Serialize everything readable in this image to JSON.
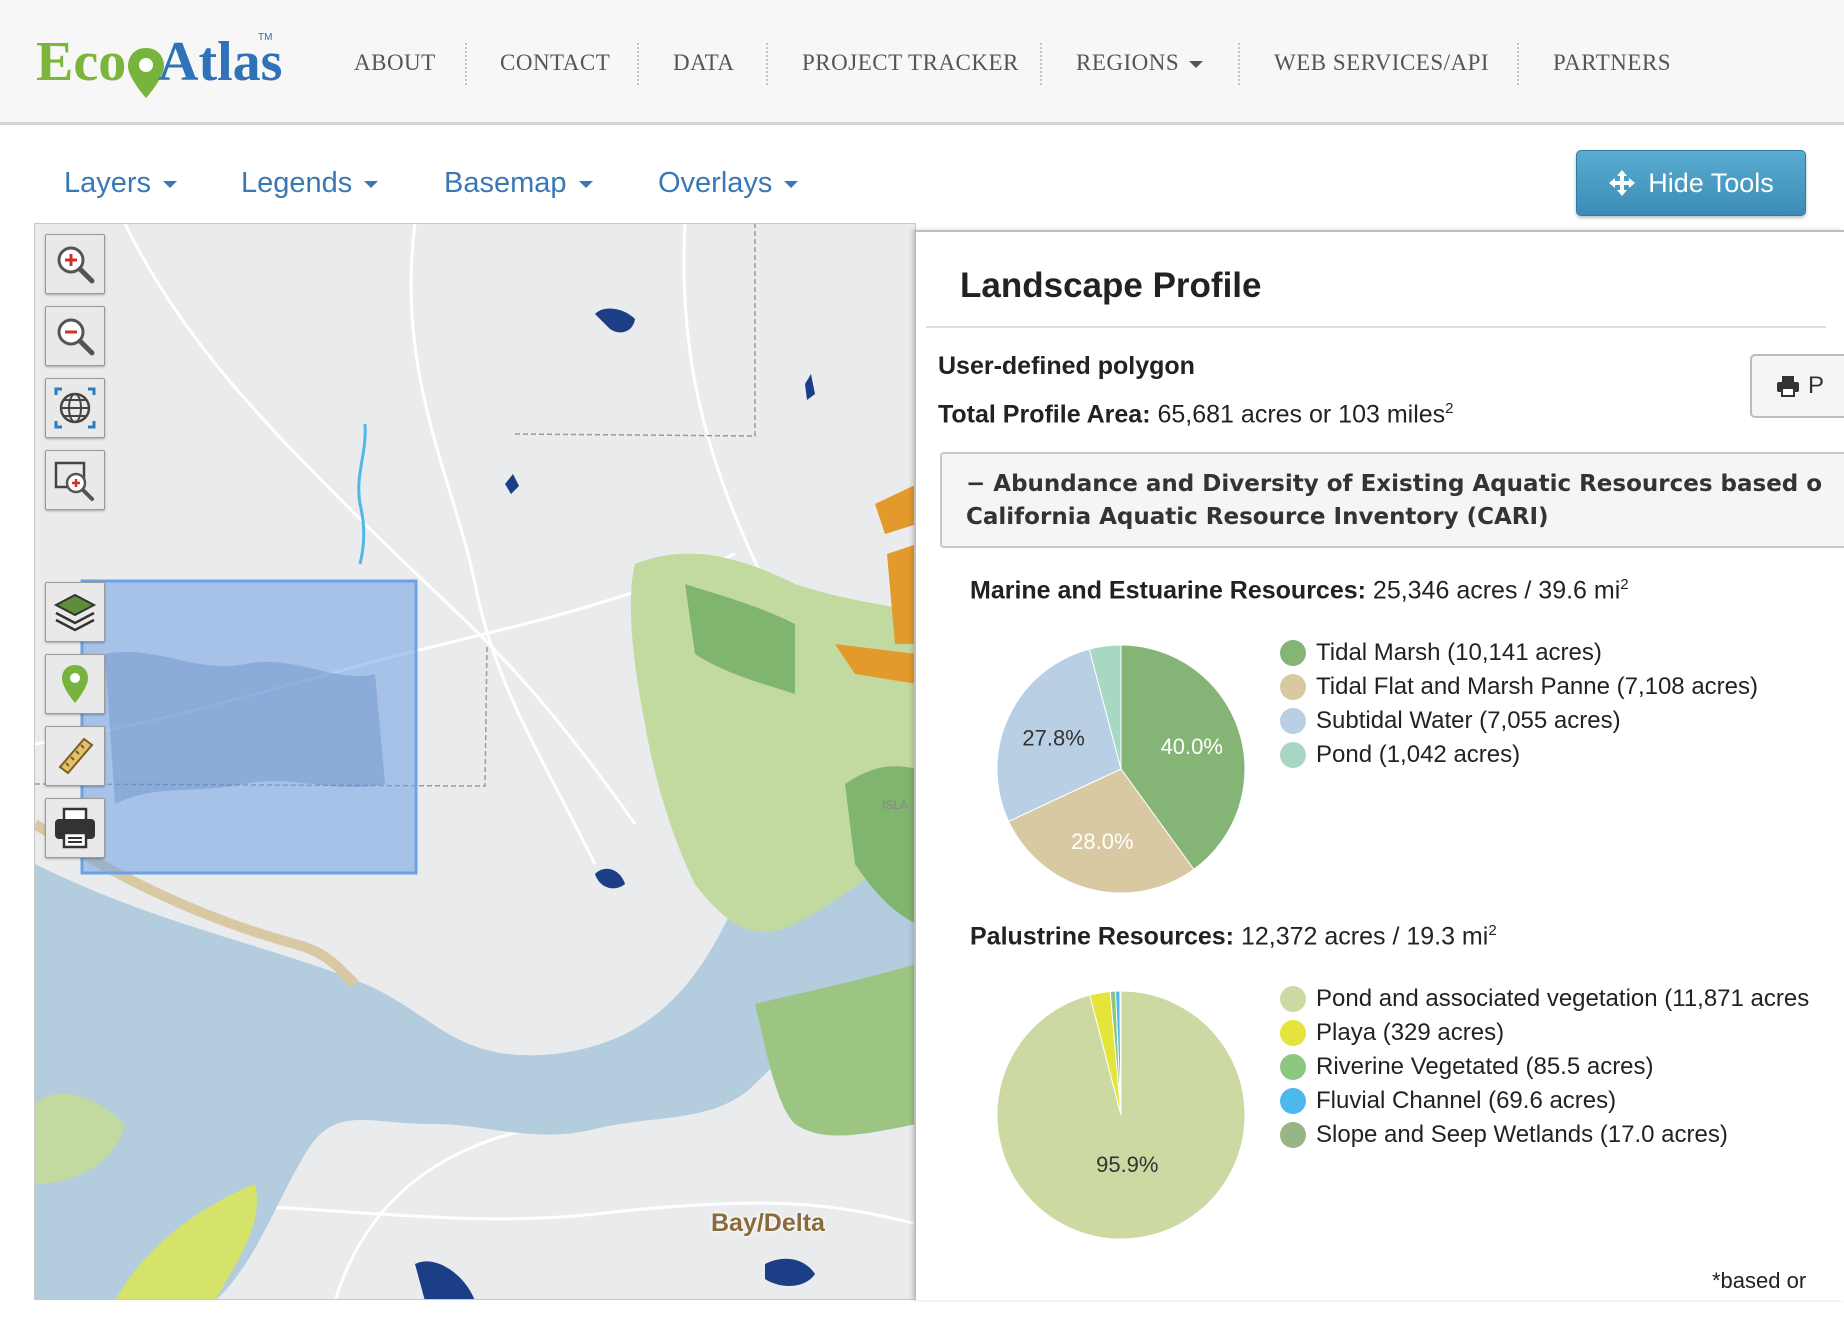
{
  "logo": {
    "text_eco": "Eco",
    "text_atlas": "Atlas",
    "tm": "TM"
  },
  "nav": {
    "items": [
      {
        "label": "ABOUT"
      },
      {
        "label": "CONTACT"
      },
      {
        "label": "DATA"
      },
      {
        "label": "PROJECT TRACKER"
      },
      {
        "label": "REGIONS"
      },
      {
        "label": "WEB SERVICES/API"
      },
      {
        "label": "PARTNERS"
      }
    ]
  },
  "toolbar": {
    "dropdowns": [
      {
        "label": "Layers"
      },
      {
        "label": "Legends"
      },
      {
        "label": "Basemap"
      },
      {
        "label": "Overlays"
      }
    ],
    "hide_tools_label": "Hide Tools"
  },
  "map": {
    "label": "Bay/Delta",
    "partial_label": "ISLA",
    "tools": [
      "zoom-in-icon",
      "zoom-out-icon",
      "globe-icon",
      "zoom-box-icon",
      "layers-icon",
      "map-pin-icon",
      "ruler-icon",
      "printer-icon"
    ]
  },
  "panel": {
    "title": "Landscape Profile",
    "polygon_label": "User-defined polygon",
    "total_area_label": "Total Profile Area:",
    "total_area_value": "65,681 acres or 103 miles",
    "total_area_sup": "2",
    "print_label": "P",
    "section_header": {
      "toggle": "−",
      "line1": "Abundance and Diversity of Existing Aquatic Resources based o",
      "line2": "California Aquatic Resource Inventory (CARI)"
    },
    "footnote": "*based or"
  },
  "colors": {
    "tidal_marsh": "#85b477",
    "tidal_flat": "#d9c9a3",
    "subtidal_water": "#b9cfe4",
    "pond": "#a8d8c4",
    "pond_veg": "#ccd9a2",
    "playa": "#e4e43a",
    "riverine_veg": "#8cc780",
    "fluvial": "#4db8ec",
    "slope_seep": "#97b585",
    "accent_blue": "#3a78b5"
  },
  "chart_data": [
    {
      "type": "pie",
      "heading_label": "Marine and Estuarine Resources:",
      "heading_value": "25,346 acres / 39.6 mi",
      "heading_sup": "2",
      "slices": [
        {
          "name": "Tidal Marsh (10,141 acres)",
          "value": 10141,
          "pct_label": "40.0%",
          "color": "#85b477",
          "label_color": "#ffffff"
        },
        {
          "name": "Tidal Flat and Marsh Panne (7,108 acres)",
          "value": 7108,
          "pct_label": "28.0%",
          "color": "#d9c9a3",
          "label_color": "#ffffff"
        },
        {
          "name": "Subtidal Water (7,055 acres)",
          "value": 7055,
          "pct_label": "27.8%",
          "color": "#b9cfe4",
          "label_color": "#333333"
        },
        {
          "name": "Pond (1,042 acres)",
          "value": 1042,
          "pct_label": "",
          "color": "#a8d8c4",
          "label_color": "#333333"
        }
      ]
    },
    {
      "type": "pie",
      "heading_label": "Palustrine Resources:",
      "heading_value": "12,372 acres / 19.3 mi",
      "heading_sup": "2",
      "slices": [
        {
          "name": "Pond and associated vegetation (11,871 acres",
          "value": 11871,
          "pct_label": "95.9%",
          "color": "#ccd9a2",
          "label_color": "#333333"
        },
        {
          "name": "Playa (329 acres)",
          "value": 329,
          "pct_label": "",
          "color": "#e4e43a",
          "label_color": "#333333"
        },
        {
          "name": "Riverine Vegetated (85.5 acres)",
          "value": 85.5,
          "pct_label": "",
          "color": "#8cc780",
          "label_color": "#333333"
        },
        {
          "name": "Fluvial Channel (69.6 acres)",
          "value": 69.6,
          "pct_label": "",
          "color": "#4db8ec",
          "label_color": "#333333"
        },
        {
          "name": "Slope and Seep Wetlands (17.0 acres)",
          "value": 17,
          "pct_label": "",
          "color": "#97b585",
          "label_color": "#333333"
        }
      ]
    }
  ]
}
